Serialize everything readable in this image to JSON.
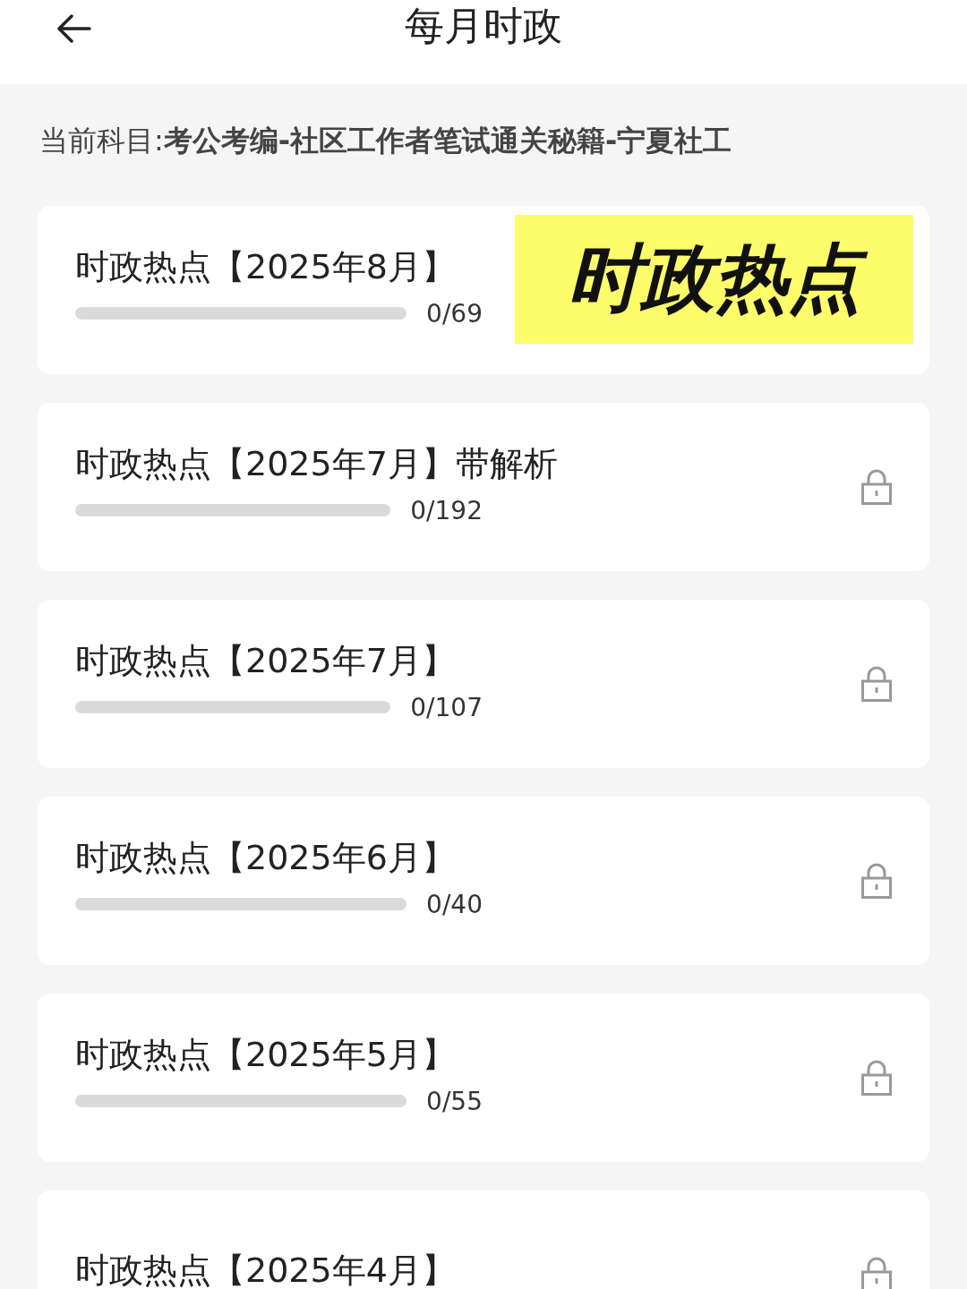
{
  "header": {
    "title": "每月时政"
  },
  "subject": "当前科目:**考公考编-社区工作者笔试通关秘籍-宁夏社工**",
  "items": [
    {
      "title": "时政热点【2025年8月】",
      "level": 0,
      "count": "0/69",
      "badge": "时政热点"
    },
    {
      "title": "时政热点【2025年7月】带解析",
      "level": 0,
      "count": "0/192",
      "locked": true
    },
    {
      "title": "时政热点【2025年7月】",
      "level": 0,
      "count": "0/107",
      "locked": true
    },
    {
      "title": "时政热点【2025年6月】",
      "level": 0,
      "count": "0/40",
      "locked": true
    },
    {
      "title": "时政热点【2025年5月】",
      "level": 0,
      "count": "0/55",
      "locked": true
    },
    {
      "title": "时政热点【2025年4月】",
      "locked": true
    }
  ]
}
